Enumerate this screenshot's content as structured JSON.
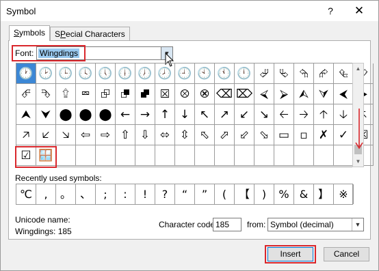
{
  "window": {
    "title": "Symbol",
    "help": "?",
    "close": "✕"
  },
  "tabs": [
    {
      "label": "Symbols",
      "access": "S",
      "rest": "ymbols"
    },
    {
      "label": "Special Characters",
      "access": "P",
      "pre": "S",
      "rest": "ecial Characters"
    }
  ],
  "font": {
    "label": "Font:",
    "value": "Wingdings"
  },
  "grid_rows": [
    [
      "🕐",
      "🕑",
      "🕒",
      "🕓",
      "🕔",
      "🕕",
      "🕖",
      "🕗",
      "🕘",
      "🕙",
      "🕚",
      "🕛",
      "⮰",
      "⮱",
      "⮲",
      "⮳",
      "⮴",
      "⮵"
    ],
    [
      "⮶",
      "⮷",
      "⮸",
      "⮹",
      "⮺",
      "⮻",
      "⮼",
      "⮽",
      "⮾",
      "⮿",
      "⌫",
      "⌦",
      "⮘",
      "⮚",
      "⮙",
      "⮛",
      "⮜",
      "⮞"
    ],
    [
      "⮝",
      "⮟",
      "⬤",
      "⬤",
      "⬤",
      "←",
      "→",
      "↑",
      "↓",
      "↖",
      "↗",
      "↙",
      "↘",
      "🡠",
      "🡢",
      "🡡",
      "🡣",
      "🡤"
    ],
    [
      "🡥",
      "🡧",
      "🡦",
      "⇦",
      "⇨",
      "⇧",
      "⇩",
      "⬄",
      "⇳",
      "⬁",
      "⬀",
      "⬃",
      "⬂",
      "▭",
      "▫",
      "✗",
      "✓",
      "☒"
    ],
    [
      "☑",
      "🪟",
      "",
      "",
      "",
      "",
      "",
      "",
      "",
      "",
      "",
      "",
      "",
      "",
      "",
      "",
      "",
      ""
    ]
  ],
  "recent": {
    "label": "Recently used symbols:",
    "symbols": [
      "℃",
      ",",
      "。",
      "、",
      ";",
      ":",
      "!",
      "?",
      "“",
      "”",
      "(",
      "【",
      ")",
      "%",
      "&",
      "】",
      "※"
    ]
  },
  "unicode": {
    "label": "Unicode name:",
    "value": "Wingdings: 185"
  },
  "char_code": {
    "label": "Character code:",
    "value": "185"
  },
  "from": {
    "label": "from:",
    "value": "Symbol (decimal)"
  },
  "buttons": {
    "insert": "Insert",
    "cancel": "Cancel"
  }
}
